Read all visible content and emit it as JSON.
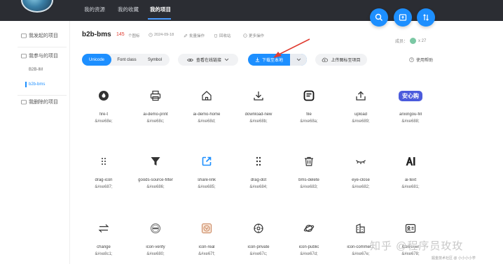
{
  "nav": {
    "items": [
      "我的资源",
      "我的收藏",
      "我的项目"
    ],
    "active_index": 2
  },
  "fab_icons": [
    "search-icon",
    "upload-box-icon",
    "sort-icon"
  ],
  "sidebar": {
    "groups": [
      "我发起的项目",
      "我参与的项目",
      "我删除的项目"
    ],
    "sub_items": [
      "B2B-IM",
      "b2b-bms"
    ],
    "active_sub": "b2b-bms"
  },
  "project": {
    "name": "b2b-bms",
    "icon_count": "145",
    "icon_count_label": "个图标",
    "date": "2024-09-18",
    "batch_action": "批量操作",
    "recycle": "回收站",
    "more": "更多操作",
    "members_label": "成员：",
    "members_count": "x 27"
  },
  "toolbar": {
    "tabs": [
      "Unicode",
      "Font class",
      "Symbol"
    ],
    "active_tab": "Unicode",
    "view_online": "查看在线链接",
    "download_local": "下载至本地",
    "upload": "上传图标至项目",
    "help": "使用帮助"
  },
  "icons": [
    {
      "name": "fire-t",
      "code": "&#xe68e;",
      "icon": "fire-icon"
    },
    {
      "name": "ai-demo-print",
      "code": "&#xe68c;",
      "icon": "printer-icon"
    },
    {
      "name": "ai-demo-home",
      "code": "&#xe68d;",
      "icon": "home-icon"
    },
    {
      "name": "download-new",
      "code": "&#xe68b;",
      "icon": "download-icon"
    },
    {
      "name": "file",
      "code": "&#xe68a;",
      "icon": "file-icon"
    },
    {
      "name": "upload",
      "code": "&#xe689;",
      "icon": "upload-icon"
    },
    {
      "name": "anxingou-fill",
      "code": "&#xe688;",
      "icon": "anxingou-badge-icon",
      "badge_text": "安心购"
    },
    {
      "name": "drag-icon",
      "code": "&#xe687;",
      "icon": "drag-icon"
    },
    {
      "name": "goods-source-filter",
      "code": "&#xe686;",
      "icon": "filter-icon"
    },
    {
      "name": "share-link",
      "code": "&#xe685;",
      "icon": "share-link-icon"
    },
    {
      "name": "drag-dot",
      "code": "&#xe684;",
      "icon": "drag-dot-icon"
    },
    {
      "name": "bms-delete",
      "code": "&#xe683;",
      "icon": "trash-icon"
    },
    {
      "name": "eye-close",
      "code": "&#xe682;",
      "icon": "eye-close-icon"
    },
    {
      "name": "ai-text",
      "code": "&#xe681;",
      "icon": "ai-text-icon"
    },
    {
      "name": "change",
      "code": "&#xe8c1;",
      "icon": "swap-icon"
    },
    {
      "name": "icon-verify",
      "code": "&#xe680;",
      "icon": "verify-stamp-icon"
    },
    {
      "name": "icon-real",
      "code": "&#xe67f;",
      "icon": "real-stamp-icon"
    },
    {
      "name": "icon-private",
      "code": "&#xe67c;",
      "icon": "private-icon"
    },
    {
      "name": "icon-public",
      "code": "&#xe67d;",
      "icon": "planet-icon"
    },
    {
      "name": "icon-commer...",
      "code": "&#xe67e;",
      "icon": "building-icon"
    },
    {
      "name": "icon-user",
      "code": "&#xe678;",
      "icon": "id-card-icon"
    }
  ],
  "watermark": {
    "text": "知乎 @程序员玫玫",
    "sub": "掘金技术社区 @ 小小小小学"
  },
  "colors": {
    "accent": "#1d8fff",
    "topbar": "#2b2d33",
    "count_red": "#e03c31",
    "arrow_red": "#e03c31"
  }
}
